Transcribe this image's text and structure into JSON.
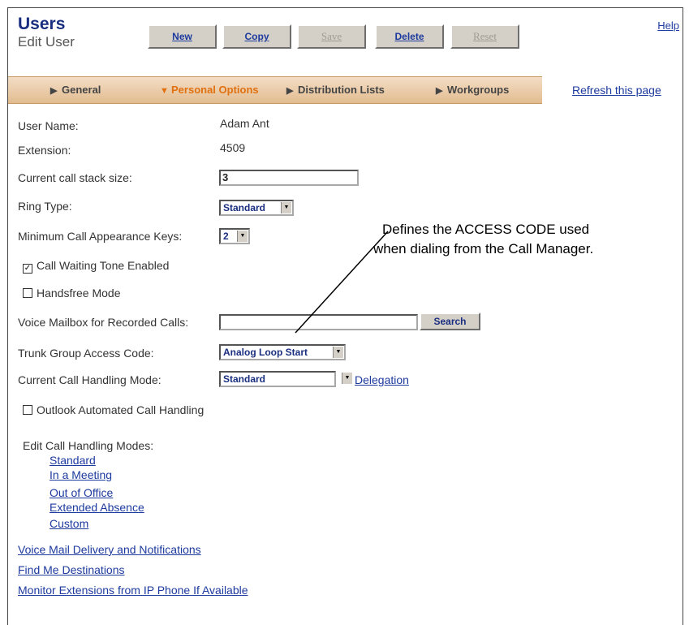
{
  "header": {
    "title": "Users",
    "subtitle": "Edit User",
    "help": "Help"
  },
  "toolbar": {
    "new_label": "New",
    "copy_label": "Copy",
    "save_label": "Save",
    "delete_label": "Delete",
    "reset_label": "Reset"
  },
  "tabs": [
    {
      "label": "General",
      "icon": "triangle-right-icon",
      "active": false
    },
    {
      "label": "Personal Options",
      "icon": "triangle-down-icon",
      "active": true
    },
    {
      "label": "Distribution Lists",
      "icon": "triangle-right-icon",
      "active": false
    },
    {
      "label": "Workgroups",
      "icon": "triangle-right-icon",
      "active": false
    }
  ],
  "refresh_link": "Refresh this page",
  "form": {
    "user_name_label": "User Name:",
    "user_name_value": "Adam Ant",
    "extension_label": "Extension:",
    "extension_value": "4509",
    "call_stack_label": "Current call stack size:",
    "call_stack_value": "3",
    "ring_type_label": "Ring Type:",
    "ring_type_value": "Standard",
    "min_keys_label": "Minimum Call Appearance Keys:",
    "min_keys_value": "2",
    "call_waiting_label": "Call Waiting Tone Enabled",
    "call_waiting_checked": true,
    "handsfree_label": "Handsfree Mode",
    "handsfree_checked": false,
    "voice_mailbox_label": "Voice Mailbox for Recorded Calls:",
    "voice_mailbox_value": "",
    "search_label": "Search",
    "trunk_label": "Trunk Group Access Code:",
    "trunk_value": "Analog Loop Start",
    "handling_mode_label": "Current Call Handling Mode:",
    "handling_mode_value": "Standard",
    "delegation_link": "Delegation",
    "outlook_label": "Outlook Automated Call Handling",
    "outlook_checked": false
  },
  "call_handling_modes": {
    "label": "Edit Call Handling Modes:",
    "items": [
      "Standard",
      "In a Meeting",
      "Out of Office",
      "Extended Absence",
      "Custom"
    ]
  },
  "bottom_links": [
    "Voice Mail Delivery and Notifications",
    "Find Me Destinations",
    "Monitor Extensions from IP Phone If Available"
  ],
  "annotation": {
    "line1": "Defines the ACCESS CODE used",
    "line2": "when dialing from the Call Manager."
  },
  "colors": {
    "title": "#1a2e80",
    "link": "#1d3a9e",
    "active_tab": "#e07010",
    "tab_bar": "#e8c9a3"
  }
}
